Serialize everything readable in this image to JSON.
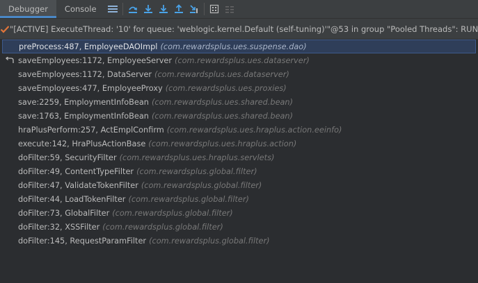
{
  "toolbar": {
    "tabs": [
      {
        "label": "Debugger",
        "active": true
      },
      {
        "label": "Console",
        "active": false
      }
    ],
    "icons": [
      "menu-icon",
      "show-execution-point-icon",
      "step-over-icon",
      "step-into-icon",
      "step-out-icon",
      "run-to-cursor-icon",
      "evaluate-expression-icon",
      "trace-table-icon"
    ]
  },
  "thread": {
    "text": "\"[ACTIVE] ExecuteThread: '10' for queue: 'weblogic.kernel.Default (self-tuning)'\"@53 in group \"Pooled Threads\": RUNNING",
    "status_color": "#e0753a"
  },
  "frames": [
    {
      "method": "preProcess:487, EmployeeDAOImpl",
      "pkg": "(com.rewardsplus.ues.suspense.dao)",
      "selected": true
    },
    {
      "method": "saveEmployees:1172, EmployeeServer",
      "pkg": "(com.rewardsplus.ues.dataserver)",
      "drop_frame": true
    },
    {
      "method": "saveEmployees:1172, DataServer",
      "pkg": "(com.rewardsplus.ues.dataserver)"
    },
    {
      "method": "saveEmployees:477, EmployeeProxy",
      "pkg": "(com.rewardsplus.ues.proxies)"
    },
    {
      "method": "save:2259, EmploymentInfoBean",
      "pkg": "(com.rewardsplus.ues.shared.bean)"
    },
    {
      "method": "save:1763, EmploymentInfoBean",
      "pkg": "(com.rewardsplus.ues.shared.bean)"
    },
    {
      "method": "hraPlusPerform:257, ActEmplConfirm",
      "pkg": "(com.rewardsplus.ues.hraplus.action.eeinfo)"
    },
    {
      "method": "execute:142, HraPlusActionBase",
      "pkg": "(com.rewardsplus.ues.hraplus.action)"
    },
    {
      "method": "doFilter:59, SecurityFilter",
      "pkg": "(com.rewardsplus.ues.hraplus.servlets)"
    },
    {
      "method": "doFilter:49, ContentTypeFilter",
      "pkg": "(com.rewardsplus.global.filter)"
    },
    {
      "method": "doFilter:47, ValidateTokenFilter",
      "pkg": "(com.rewardsplus.global.filter)"
    },
    {
      "method": "doFilter:44, LoadTokenFilter",
      "pkg": "(com.rewardsplus.global.filter)"
    },
    {
      "method": "doFilter:73, GlobalFilter",
      "pkg": "(com.rewardsplus.global.filter)"
    },
    {
      "method": "doFilter:32, XSSFilter",
      "pkg": "(com.rewardsplus.global.filter)"
    },
    {
      "method": "doFilter:145, RequestParamFilter",
      "pkg": "(com.rewardsplus.global.filter)"
    }
  ]
}
